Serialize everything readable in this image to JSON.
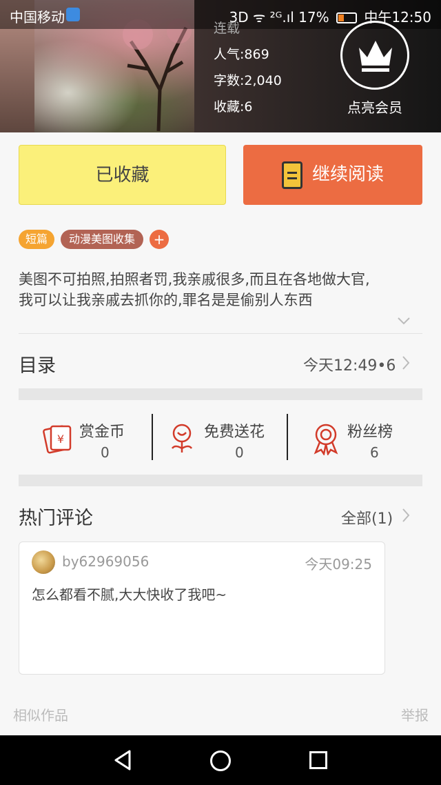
{
  "status_bar": {
    "carrier": "中国移动",
    "signal_right": "3D ᯤ ²ᴳ.ıl 17%",
    "time": "中午12:50"
  },
  "book": {
    "serial": "连载",
    "popularity": "人气:869",
    "words": "字数:2,040",
    "favorites": "收藏:6",
    "vip_label": "点亮会员"
  },
  "actions": {
    "collected": "已收藏",
    "continue_reading": "继续阅读"
  },
  "tags": {
    "short": "短篇",
    "anime": "动漫美图收集",
    "add": "+"
  },
  "description": {
    "line1": "美图不可拍照,拍照者罚,我亲戚很多,而且在各地做大官,",
    "line2": "我可以让我亲戚去抓你的,罪名是是偷别人东西"
  },
  "catalog": {
    "title": "目录",
    "meta": "今天12:49•6"
  },
  "rewards": [
    {
      "label": "赏金币",
      "count": "0",
      "icon": "coin-envelope-icon"
    },
    {
      "label": "免费送花",
      "count": "0",
      "icon": "flower-icon"
    },
    {
      "label": "粉丝榜",
      "count": "6",
      "icon": "ribbon-medal-icon"
    }
  ],
  "comments": {
    "title": "热门评论",
    "all": "全部(1)",
    "items": [
      {
        "user": "by62969056",
        "time": "今天09:25",
        "text": "怎么都看不腻,大大快收了我吧~"
      }
    ]
  },
  "footer": {
    "similar": "相似作品",
    "report": "举报"
  },
  "colors": {
    "collected_bg": "#fbf07a",
    "read_bg": "#ec6c42",
    "tag_short": "#f5a431",
    "tag_anime": "#b26354",
    "icon_red": "#d23b2a"
  }
}
